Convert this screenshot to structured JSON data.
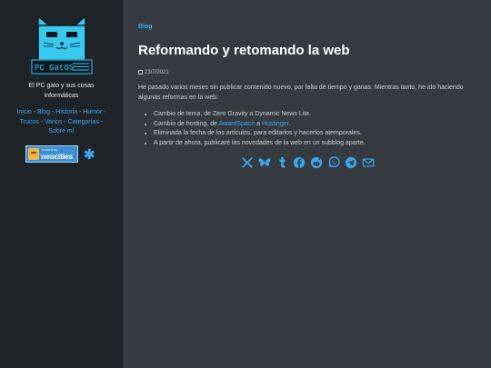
{
  "site": {
    "logo_text": "PC GatOS",
    "tagline": "El PC gato y sus cosas informáticas",
    "nav": {
      "inicio": "Inicio",
      "blog": "Blog",
      "historia": "Historia",
      "humor": "Humor",
      "trucos": "Trucos",
      "varios": "Varios",
      "categorias": "Categorías",
      "sobre_mi": "Sobre mí",
      "separator": " - "
    },
    "badge": {
      "small": "hosted by",
      "big": "neocities"
    }
  },
  "post": {
    "category": "Blog",
    "title": "Reformando y retomando la web",
    "date": "23/7/2021",
    "intro": "He pasado varios meses sin publicar contenido nuevo, por falta de tiempo y ganas. Mientras tanto, he ido haciendo algunas reformas en la web:",
    "changes": [
      {
        "text": "Cambio de tema, de Zero Gravity a Dynamic News Lite."
      },
      {
        "pre": "Cambio de hosting, de ",
        "link1": "AwardSpace",
        "mid": " a ",
        "link2": "Hostinger",
        "post": "."
      },
      {
        "text": "Eliminada la fecha de los artículos, para editarlos y hacerlos atemporales."
      },
      {
        "text": "A partir de ahora, publicaré las novedades de la web en un subblog aparte."
      }
    ]
  },
  "share_icons": [
    "x-icon",
    "bluesky-icon",
    "tumblr-icon",
    "facebook-icon",
    "reddit-icon",
    "whatsapp-icon",
    "telegram-icon",
    "email-icon"
  ],
  "colors": {
    "accent": "#3aa7ec",
    "sidebar_bg": "#1f2429",
    "main_bg": "#353b41",
    "logo_cyan": "#39c8ee"
  }
}
